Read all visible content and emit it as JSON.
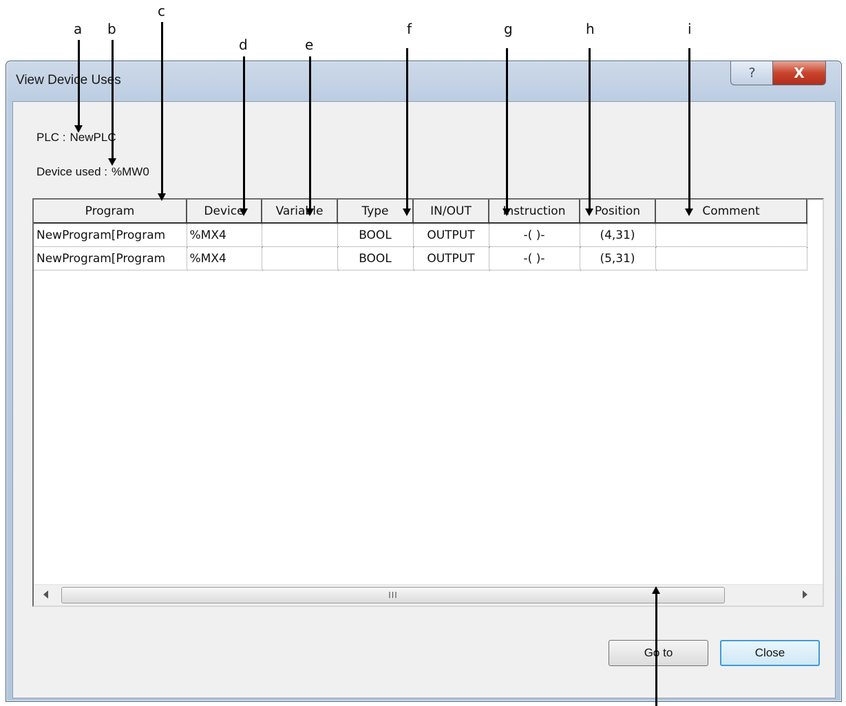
{
  "window": {
    "title": "View Device Uses",
    "help_glyph": "?",
    "close_glyph": "X"
  },
  "info": {
    "plc_label": "PLC :",
    "plc_value": "NewPLC",
    "device_label": "Device used :",
    "device_value": "%MW0"
  },
  "table": {
    "columns": [
      "Program",
      "Device",
      "Variable",
      "Type",
      "IN/OUT",
      "Instruction",
      "Position",
      "Comment"
    ],
    "rows": [
      [
        "NewProgram[Program",
        "%MX4",
        "",
        "BOOL",
        "OUTPUT",
        "-( )-",
        "(4,31)",
        ""
      ],
      [
        "NewProgram[Program",
        "%MX4",
        "",
        "BOOL",
        "OUTPUT",
        "-( )-",
        "(5,31)",
        ""
      ]
    ]
  },
  "scrollbar": {
    "thumb_grip": "III"
  },
  "buttons": {
    "goto": "Go to",
    "close": "Close"
  },
  "annotations": {
    "a": "a",
    "b": "b",
    "c": "c",
    "d": "d",
    "e": "e",
    "f": "f",
    "g": "g",
    "h": "h",
    "i": "i"
  },
  "icons": {
    "help": "help-icon",
    "close": "close-icon",
    "scroll_left": "chevron-left-icon",
    "scroll_right": "chevron-right-icon"
  }
}
